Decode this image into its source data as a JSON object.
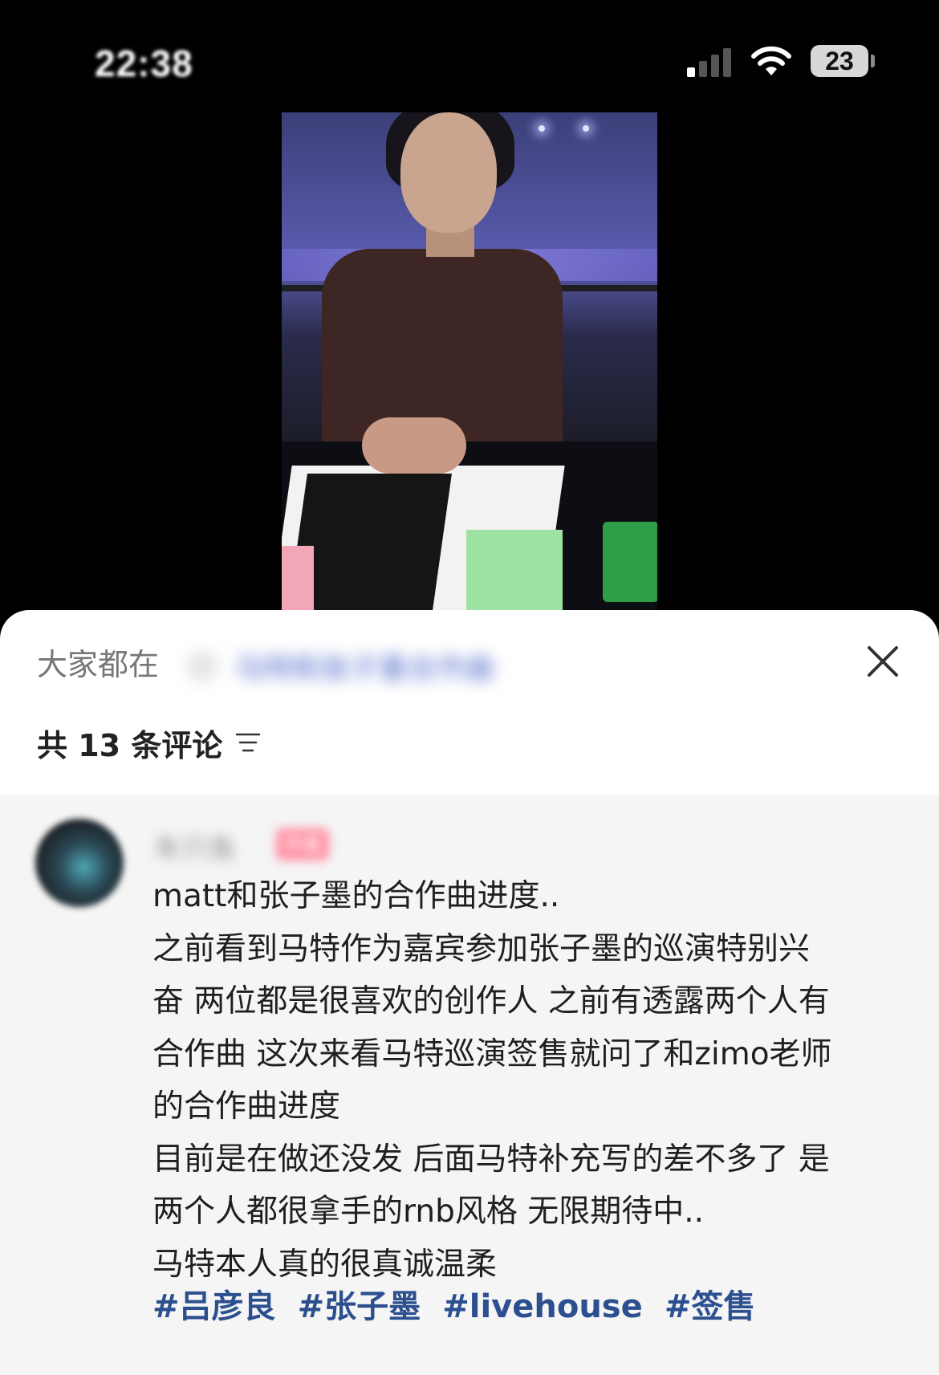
{
  "status_bar": {
    "time": "22:38",
    "battery": "23"
  },
  "panel": {
    "suggest_label": "大家都在",
    "suggest_query": "马特和张子墨合作曲",
    "comment_count": "共 13 条评论"
  },
  "comment": {
    "username": "朱只鱼",
    "badge": "作者",
    "lines": [
      "matt和张子墨的合作曲进度..",
      "之前看到马特作为嘉宾参加张子墨的巡演特别兴",
      "奋 两位都是很喜欢的创作人 之前有透露两个人有",
      "合作曲 这次来看马特巡演签售就问了和zimo老师",
      "的合作曲进度",
      "目前是在做还没发 后面马特补充写的差不多了 是",
      "两个人都很拿手的rnb风格 无限期待中..",
      "马特本人真的很真诚温柔"
    ],
    "tags": [
      "#吕彦良",
      "#张子墨",
      "#livehouse",
      "#签售"
    ]
  },
  "colors": {
    "tag": "#2c4f8f",
    "panel_bg": "#ffffff",
    "comment_bg": "#f5f5f5"
  }
}
